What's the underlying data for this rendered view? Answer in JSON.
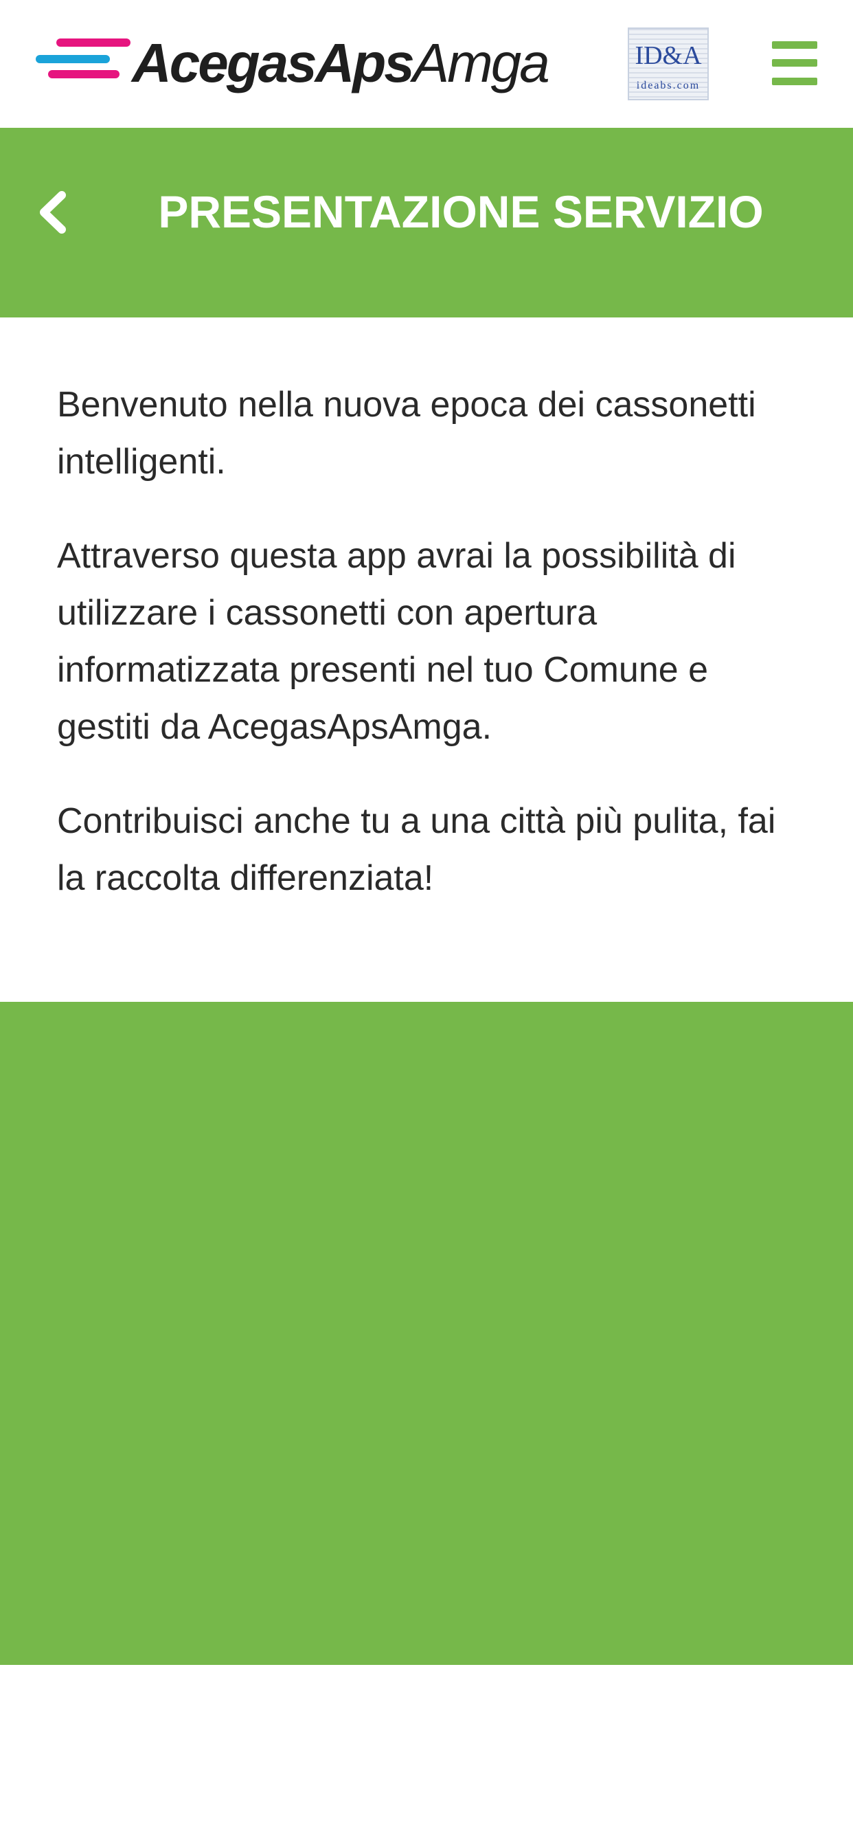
{
  "header": {
    "logo": {
      "name": "acegasapsamga-logo",
      "text_bold": "AcegasAps",
      "text_light": "Amga",
      "colors": {
        "stripe_blue": "#1aa3d9",
        "stripe_magenta": "#e6157f"
      }
    },
    "partner_badge": {
      "name": "ideabs-logo",
      "brand": "ID&A",
      "site": "ideabs.com"
    },
    "menu_icon": "hamburger-menu-icon"
  },
  "title_bar": {
    "back_icon": "chevron-left-icon",
    "title": "PRESENTAZIONE SERVIZIO"
  },
  "content": {
    "paragraphs": [
      "Benvenuto nella nuova epoca dei cassonetti intelligenti.",
      "Attraverso questa app avrai la possibilità di utilizzare i cassonetti con apertura informatizzata presenti nel tuo Comune e gestiti da AcegasApsAmga.",
      "Contribuisci anche tu a una città più pulita, fai la raccolta differenziata!"
    ]
  },
  "colors": {
    "accent_green": "#76b84a",
    "text": "#2a2a2a",
    "background": "#ffffff"
  }
}
